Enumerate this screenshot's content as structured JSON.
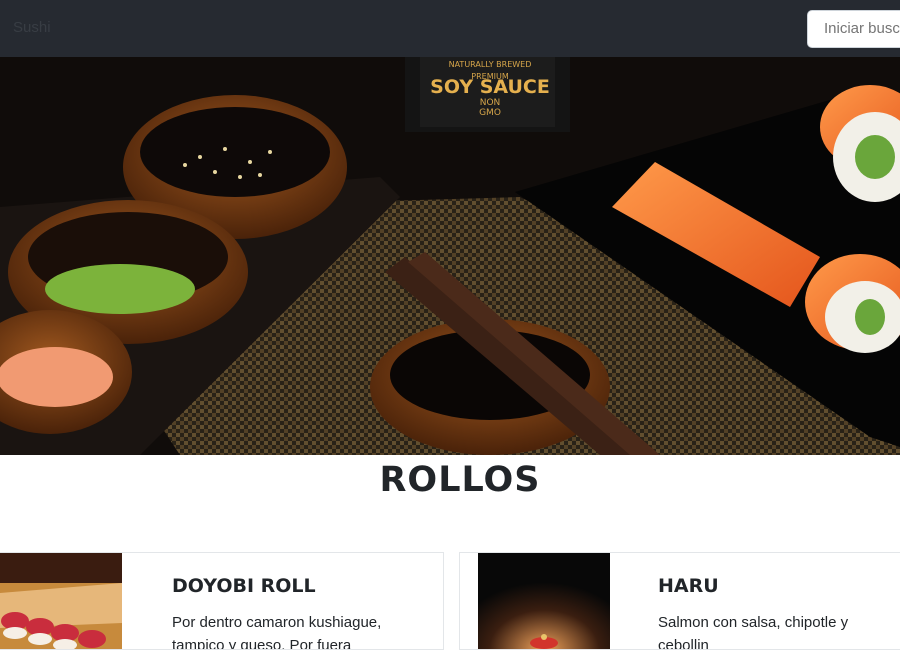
{
  "navbar": {
    "brand": "Sushi",
    "search_placeholder": "Iniciar busc"
  },
  "carousel": {
    "bottle_label": {
      "line1": "NATURALLY BREWED",
      "line2": "PREMIUM",
      "line3": "SOY SAUCE",
      "line4": "NON",
      "line5": "GMO"
    },
    "indicators": [
      true,
      false,
      false
    ]
  },
  "section": {
    "title": "ROLLOS"
  },
  "cards": [
    {
      "title": "DOYOBI ROLL",
      "text_line1": "Por dentro camaron kushiague,",
      "text_line2": "tampico y queso. Por fuera"
    },
    {
      "title": "HARU",
      "text_line1": "Salmon con salsa, chipotle y",
      "text_line2": "cebollin"
    }
  ]
}
